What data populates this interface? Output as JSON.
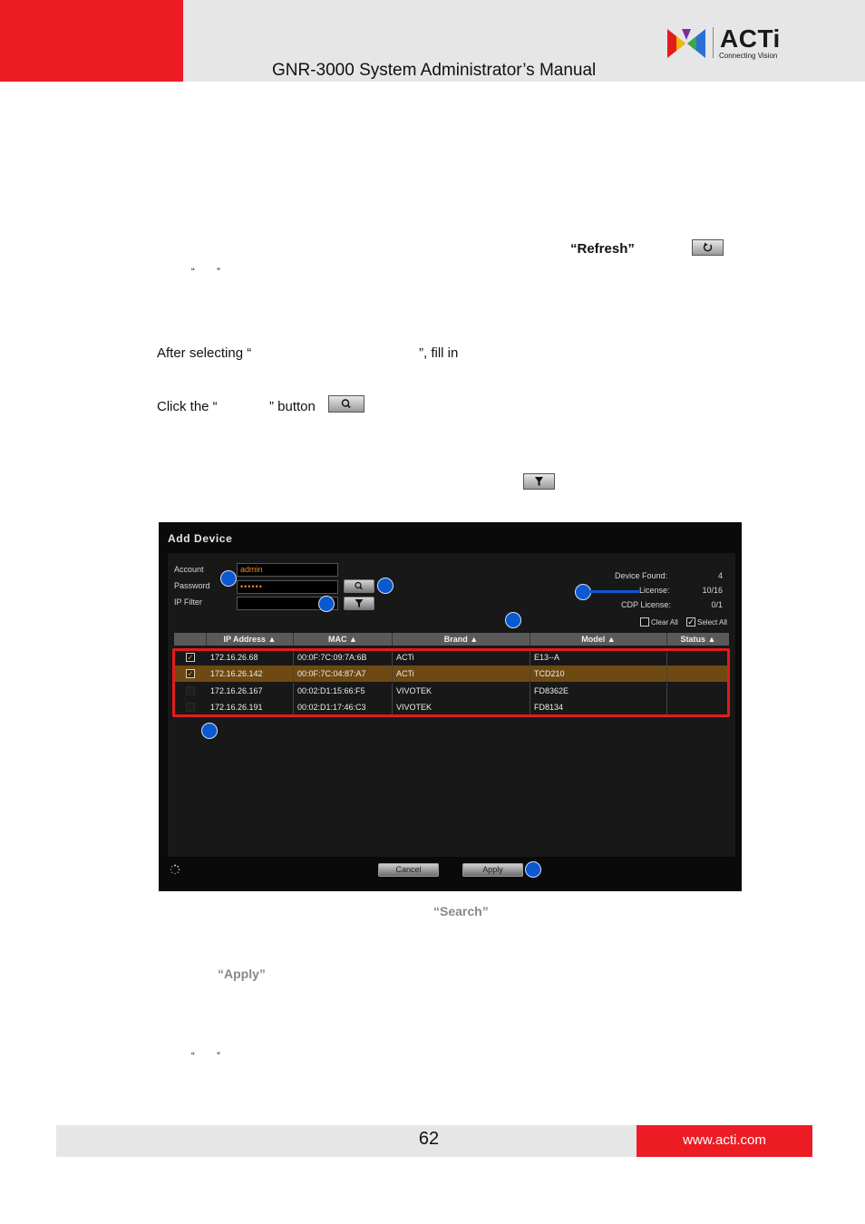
{
  "header": {
    "title": "GNR-3000 System Administrator’s Manual",
    "logo_text": "ACTi",
    "logo_tagline": "Connecting Vision"
  },
  "body": {
    "refresh_label": "“Refresh”",
    "quote_pair_1": "“        ”",
    "after_selecting_start": "After selecting “",
    "after_selecting_end": "”, fill in",
    "click_the_start": "Click the “",
    "click_the_end": "” button",
    "caption_search": "“Search”",
    "caption_apply": "“Apply”",
    "quote_pair_2": "“        ”"
  },
  "dialog": {
    "title": "Add Device",
    "account_label": "Account",
    "account_value": "admin",
    "password_label": "Password",
    "password_value": "••••••",
    "ip_filter_label": "IP Filter",
    "ip_filter_value": "",
    "device_found_label": "Device Found:",
    "device_found_value": "4",
    "license_label": "License:",
    "license_value": "10/16",
    "cdp_license_label": "CDP License:",
    "cdp_license_value": "0/1",
    "clear_all_label": "Clear All",
    "select_all_label": "Select All",
    "columns": [
      "IP Address ▲",
      "MAC ▲",
      "Brand ▲",
      "Model ▲",
      "Status ▲"
    ],
    "rows": [
      {
        "checked": true,
        "ip": "172.16.26.68",
        "mac": "00:0F:7C:09:7A:6B",
        "brand": "ACTi",
        "model": "E13--A",
        "status": ""
      },
      {
        "checked": true,
        "ip": "172.16.26.142",
        "mac": "00:0F:7C:04:87:A7",
        "brand": "ACTi",
        "model": "TCD210",
        "status": ""
      },
      {
        "checked": false,
        "ip": "172.16.26.167",
        "mac": "00:02:D1:15:66:F5",
        "brand": "VIVOTEK",
        "model": "FD8362E",
        "status": ""
      },
      {
        "checked": false,
        "ip": "172.16.26.191",
        "mac": "00:02:D1:17:46:C3",
        "brand": "VIVOTEK",
        "model": "FD8134",
        "status": ""
      }
    ],
    "cancel_label": "Cancel",
    "apply_label": "Apply",
    "icons": [
      "search-icon",
      "filter-icon",
      "refresh-icon",
      "spinner-icon"
    ],
    "colors": {
      "selected_row": "#6e4a12",
      "highlight_box": "#e31b1b",
      "badge": "#0b58d0",
      "input_text": "#f08a30"
    }
  },
  "footer": {
    "page_number": "62",
    "url": "www.acti.com"
  },
  "colors": {
    "brand_red": "#ed1c24",
    "band_gray": "#e6e6e6"
  }
}
